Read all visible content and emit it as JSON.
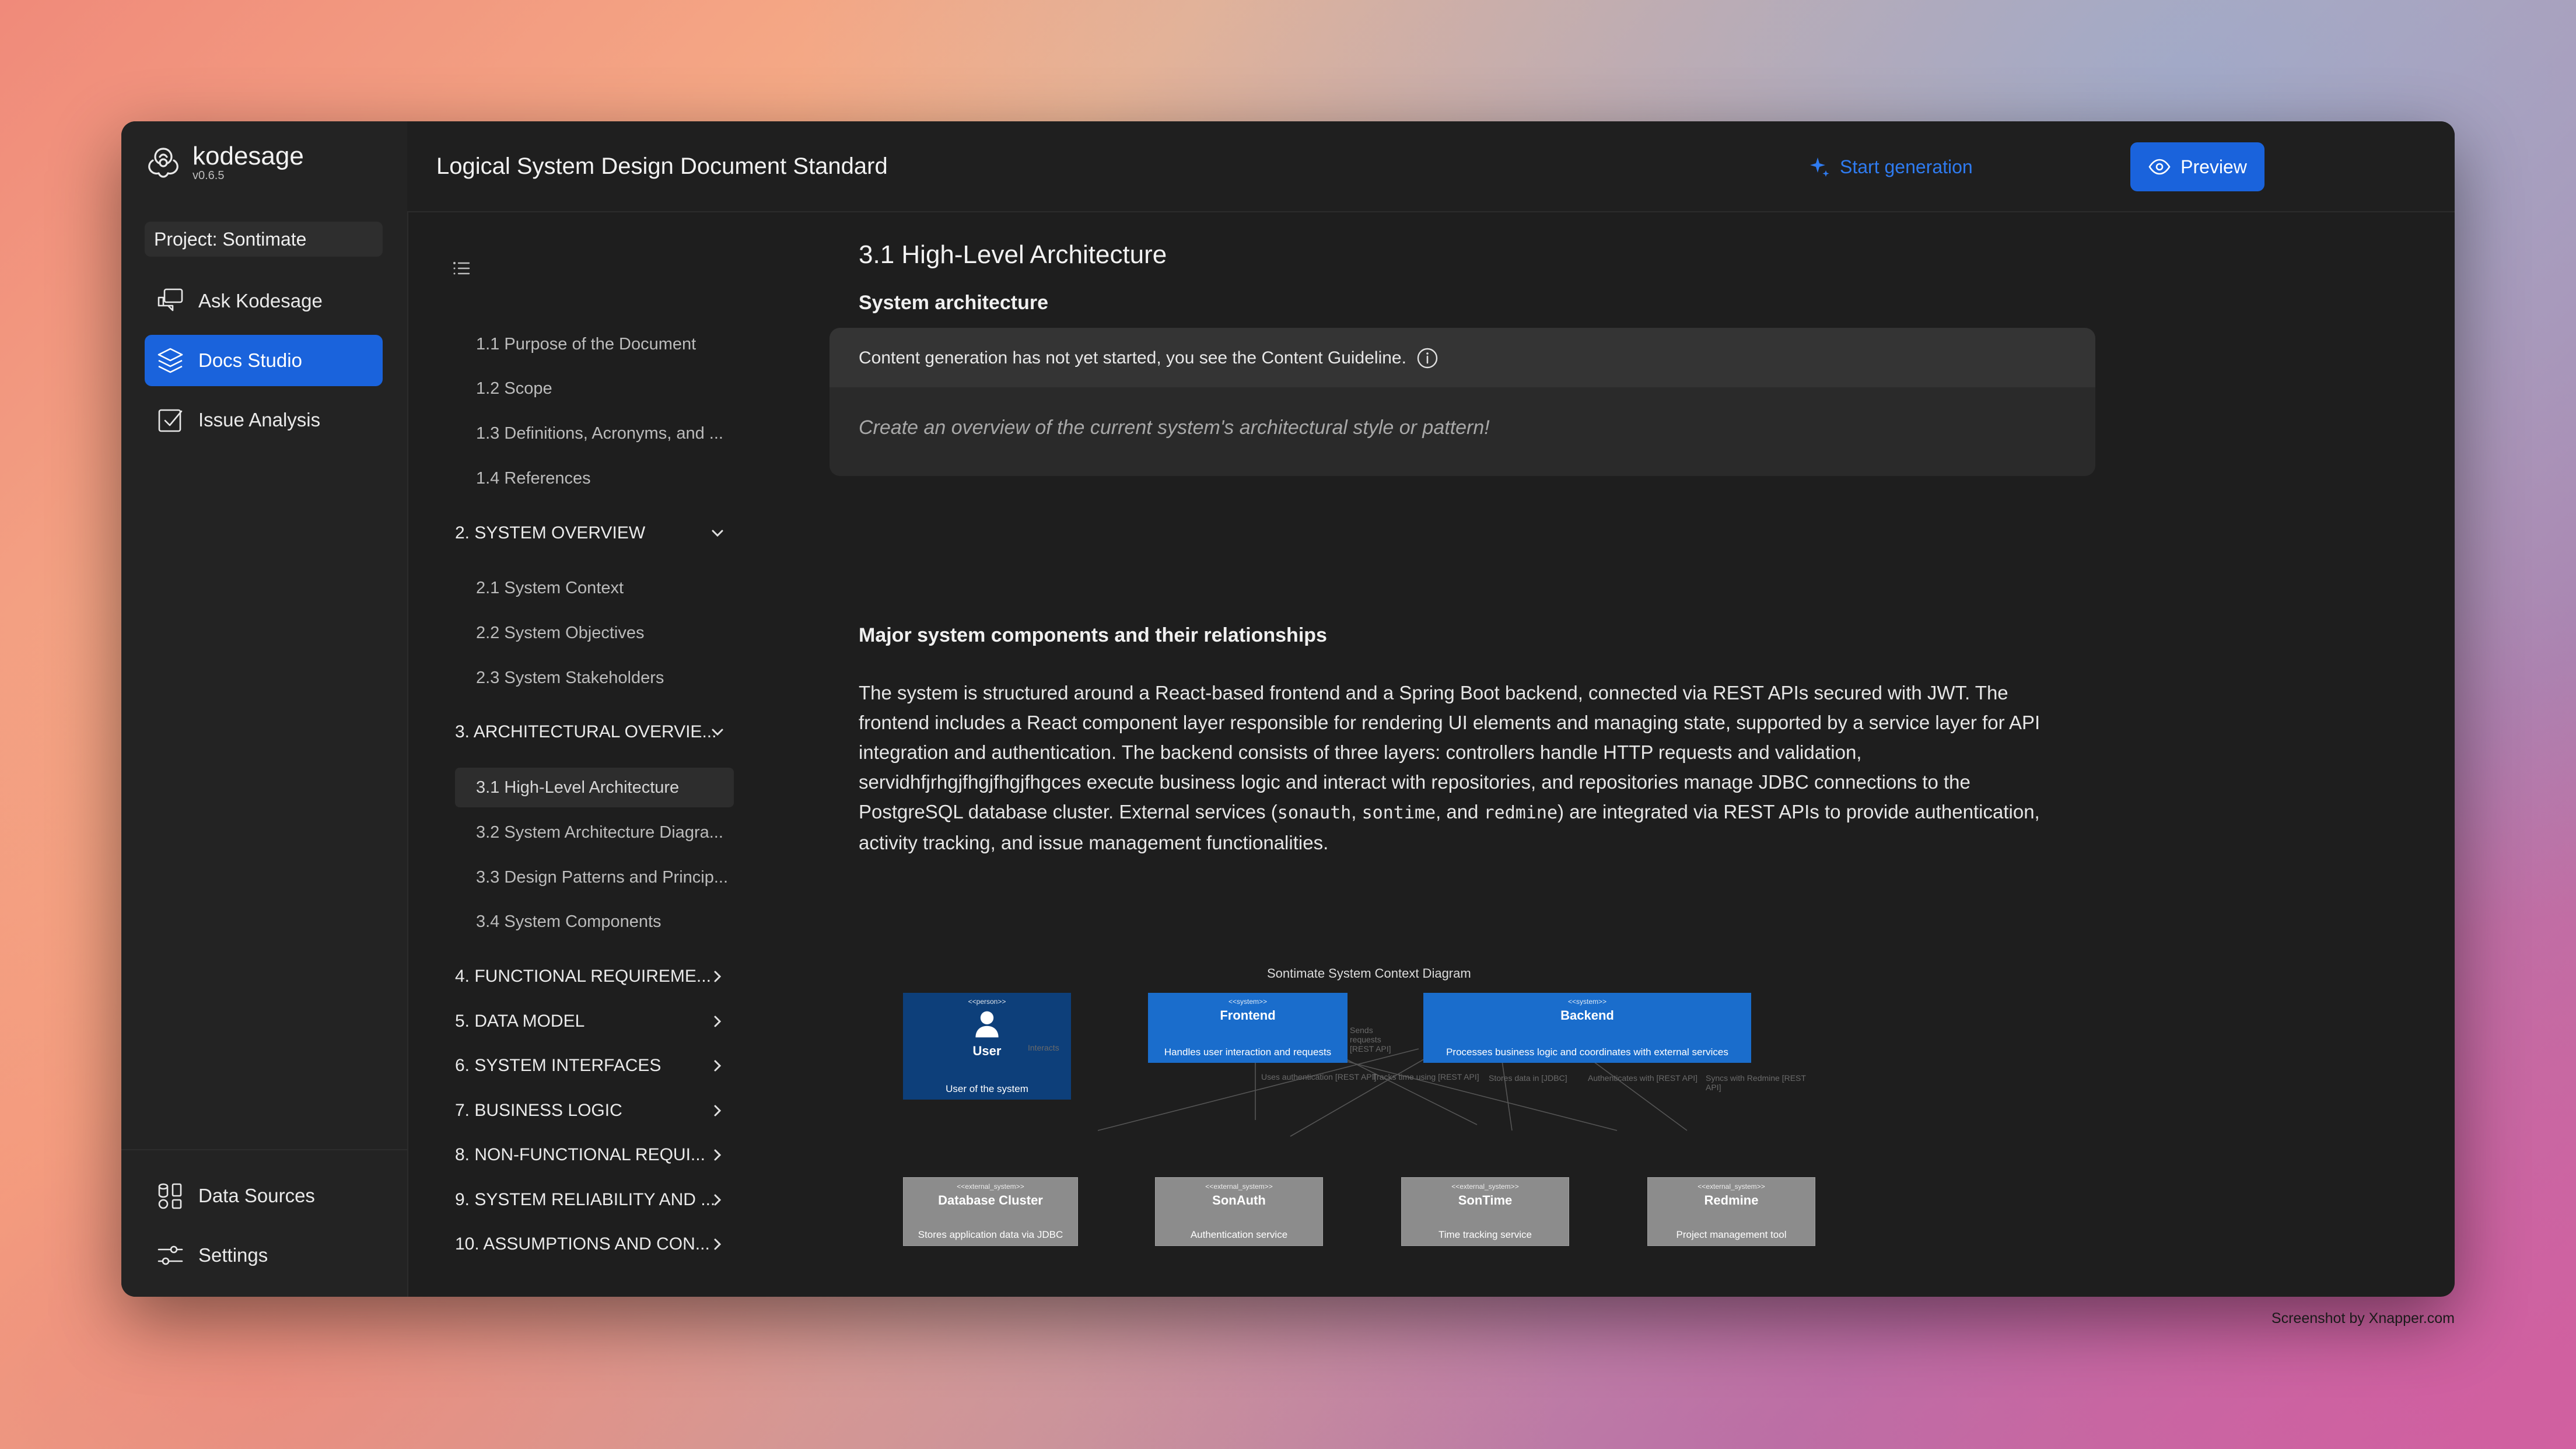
{
  "app": {
    "name": "kodesage",
    "version": "v0.6.5",
    "project": "Project: Sontimate",
    "nav": [
      {
        "label": "Ask Kodesage",
        "icon": "chat-icon",
        "active": false
      },
      {
        "label": "Docs Studio",
        "icon": "layers-icon",
        "active": true
      },
      {
        "label": "Issue Analysis",
        "icon": "checkbox-icon",
        "active": false
      }
    ],
    "bottom_nav": [
      {
        "label": "Data Sources",
        "icon": "data-sources-icon"
      },
      {
        "label": "Settings",
        "icon": "sliders-icon"
      }
    ]
  },
  "header": {
    "title": "Logical System Design Document Standard",
    "start_generation": "Start generation",
    "preview": "Preview"
  },
  "toc": {
    "items": [
      {
        "label": "1.1 Purpose of the Document",
        "type": "item"
      },
      {
        "label": "1.2 Scope",
        "type": "item"
      },
      {
        "label": "1.3 Definitions, Acronyms, and ...",
        "type": "item"
      },
      {
        "label": "1.4 References",
        "type": "item"
      },
      {
        "label": "2. SYSTEM OVERVIEW",
        "type": "section",
        "expanded": true
      },
      {
        "label": "2.1 System Context",
        "type": "item"
      },
      {
        "label": "2.2 System Objectives",
        "type": "item"
      },
      {
        "label": "2.3 System Stakeholders",
        "type": "item"
      },
      {
        "label": "3. ARCHITECTURAL OVERVIE...",
        "type": "section",
        "expanded": true
      },
      {
        "label": "3.1 High-Level Architecture",
        "type": "item",
        "active": true
      },
      {
        "label": "3.2 System Architecture Diagra...",
        "type": "item"
      },
      {
        "label": "3.3 Design Patterns and Princip...",
        "type": "item"
      },
      {
        "label": "3.4 System Components",
        "type": "item"
      },
      {
        "label": "4. FUNCTIONAL REQUIREME...",
        "type": "section",
        "expanded": false
      },
      {
        "label": "5. DATA MODEL",
        "type": "section",
        "expanded": false
      },
      {
        "label": "6. SYSTEM INTERFACES",
        "type": "section",
        "expanded": false
      },
      {
        "label": "7. BUSINESS LOGIC",
        "type": "section",
        "expanded": false
      },
      {
        "label": "8. NON-FUNCTIONAL REQUI...",
        "type": "section",
        "expanded": false
      },
      {
        "label": "9. SYSTEM RELIABILITY AND ...",
        "type": "section",
        "expanded": false
      },
      {
        "label": "10. ASSUMPTIONS AND CON...",
        "type": "section",
        "expanded": false
      }
    ]
  },
  "content": {
    "section_title": "3.1 High-Level Architecture",
    "subsection1": "System architecture",
    "guideline_notice": "Content generation has not yet started, you see the Content Guideline.",
    "guideline_text": "Create an overview of the current system's architectural style or pattern!",
    "subsection2": "Major system components and their relationships",
    "paragraph_parts": {
      "p1": "The system is structured around a React-based frontend and a Spring Boot backend, connected via REST APIs secured with JWT. The frontend includes a React component layer responsible for rendering UI elements and managing state, supported by a service layer for API integration and authentication. The backend consists of three layers: controllers handle HTTP requests and validation, servidhfjrhgjfhgjfhgjfhgces execute business logic and interact with repositories, and repositories manage JDBC connections to the PostgreSQL database cluster. External services (",
      "c1": "sonauth",
      "p2": ", ",
      "c2": "sontime",
      "p3": ", and ",
      "c3": "redmine",
      "p4": ") are integrated via REST APIs to provide authentication, activity tracking, and issue management functionalities."
    }
  },
  "diagram": {
    "title": "Sontimate System Context Diagram",
    "nodes": {
      "user": {
        "stereotype": "<<person>>",
        "name": "User",
        "desc": "User of the system"
      },
      "frontend": {
        "stereotype": "<<system>>",
        "name": "Frontend",
        "desc": "Handles user interaction and requests"
      },
      "backend": {
        "stereotype": "<<system>>",
        "name": "Backend",
        "desc": "Processes business logic and coordinates with external services"
      },
      "db": {
        "stereotype": "<<external_system>>",
        "name": "Database Cluster",
        "desc": "Stores application data via JDBC"
      },
      "sonauth": {
        "stereotype": "<<external_system>>",
        "name": "SonAuth",
        "desc": "Authentication service"
      },
      "sontime": {
        "stereotype": "<<external_system>>",
        "name": "SonTime",
        "desc": "Time tracking service"
      },
      "redmine": {
        "stereotype": "<<external_system>>",
        "name": "Redmine",
        "desc": "Project management tool"
      }
    },
    "edge_labels": {
      "e1": "Interacts",
      "e2": "Sends requests [REST API]",
      "e3": "Uses authentication [REST API]",
      "e4": "Tracks time using [REST API]",
      "e5": "Stores data in [JDBC]",
      "e6": "Authenticates with [REST API]",
      "e7": "Syncs with Redmine [REST API]"
    }
  },
  "footer": {
    "credit": "Screenshot by Xnapper.com"
  },
  "colors": {
    "accent": "#1a63dc",
    "window_bg": "#1e1e1e",
    "sidebar_bg": "#232323",
    "node_person": "#0d3f7a",
    "node_system": "#1a6dcc",
    "node_external": "#8c8c8c"
  }
}
